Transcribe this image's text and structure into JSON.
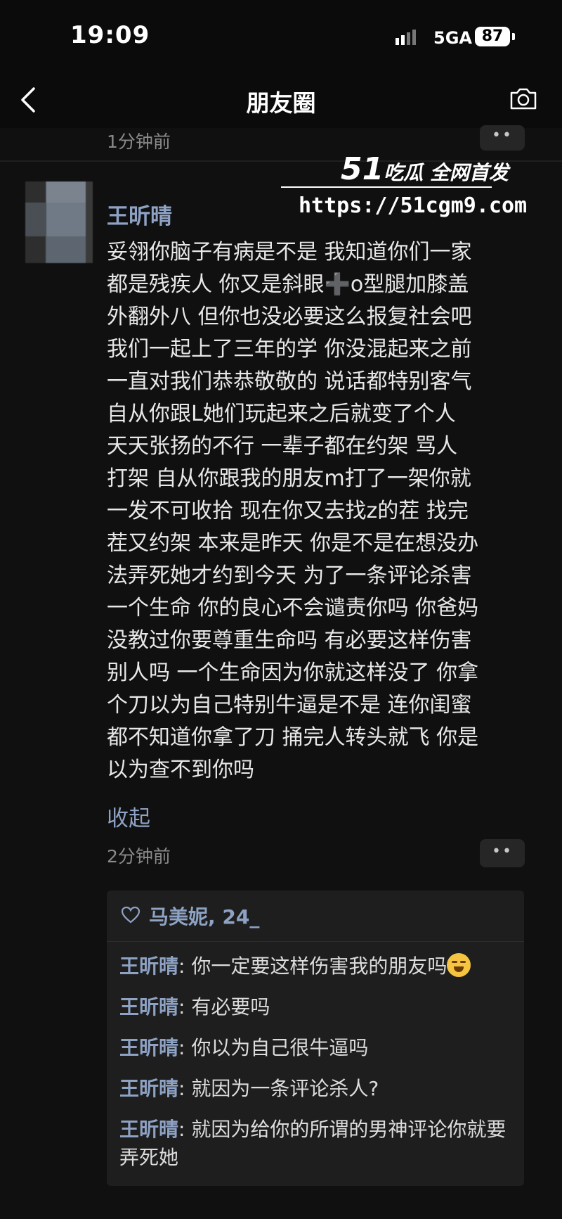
{
  "status_bar": {
    "time": "19:09",
    "network": "5GA",
    "battery": "87"
  },
  "nav": {
    "title": "朋友圈",
    "back_icon": "chevron-left-icon",
    "camera_icon": "camera-icon"
  },
  "prev_post": {
    "timestamp": "1分钟前"
  },
  "watermark": {
    "brand_number": "51",
    "brand_text": "吃瓜 全网首发",
    "url": "https://51cgm9.com"
  },
  "post": {
    "author": "王昕晴",
    "lines": [
      "妥翎你脑子有病是不是 我知道你们一家",
      "都是残疾人 你又是斜眼➕o型腿加膝盖",
      "外翻外八 但你也没必要这么报复社会吧",
      "我们一起上了三年的学 你没混起来之前",
      "一直对我们恭恭敬敬的 说话都特别客气",
      "自从你跟L她们玩起来之后就变了个人",
      "天天张扬的不行 一辈子都在约架 骂人",
      "打架 自从你跟我的朋友m打了一架你就",
      "一发不可收拾 现在你又去找z的茬 找完",
      "茬又约架 本来是昨天 你是不是在想没办",
      "法弄死她才约到今天 为了一条评论杀害",
      "一个生命 你的良心不会谴责你吗 你爸妈",
      "没教过你要尊重生命吗 有必要这样伤害",
      "别人吗 一个生命因为你就这样没了 你拿",
      "个刀以为自己特别牛逼是不是 连你闺蜜",
      "都不知道你拿了刀 捅完人转头就飞 你是",
      "以为查不到你吗"
    ],
    "collapse_label": "收起",
    "timestamp": "2分钟前",
    "more_label": "••"
  },
  "likes": {
    "text": "马美妮, 24_"
  },
  "comments": [
    {
      "author": "王昕晴",
      "sep": ": ",
      "text": "你一定要这样伤害我的朋友吗",
      "emoji": "crying-laughing-emoji"
    },
    {
      "author": "王昕晴",
      "sep": ": ",
      "text": "有必要吗"
    },
    {
      "author": "王昕晴",
      "sep": ": ",
      "text": "你以为自己很牛逼吗"
    },
    {
      "author": "王昕晴",
      "sep": ": ",
      "text": "就因为一条评论杀人?"
    },
    {
      "author": "王昕晴",
      "sep": ": ",
      "text": "就因为给你的所谓的男神评论你就要弄死她"
    }
  ]
}
